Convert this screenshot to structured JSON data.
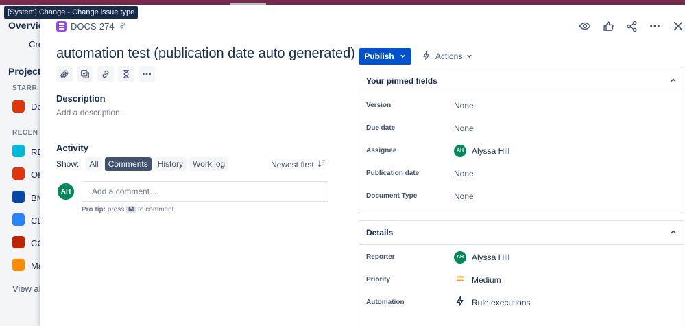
{
  "tooltip": "[System] Change - Change issue type",
  "background_sidebar": {
    "overview": "Overvie",
    "create": "Cre",
    "projects": "Projects",
    "starred": "STARR",
    "starred_item": "Do",
    "recent": "RECEN",
    "recent_items": [
      "RE",
      "OF",
      "BM",
      "CD",
      "CC",
      "Ma"
    ],
    "view_all": "View all"
  },
  "issue": {
    "key": "DOCS-274",
    "title": "automation test (publication date auto generated)"
  },
  "description": {
    "label": "Description",
    "placeholder": "Add a description..."
  },
  "activity": {
    "label": "Activity",
    "show_label": "Show:",
    "filters": [
      "All",
      "Comments",
      "History",
      "Work log"
    ],
    "active_filter": "Comments",
    "sort": "Newest first",
    "comment_placeholder": "Add a comment...",
    "protip_prefix": "Pro tip:",
    "protip_middle": "press",
    "protip_key": "M",
    "protip_suffix": "to comment",
    "avatar_initials": "AH"
  },
  "header_actions": {
    "publish": "Publish",
    "actions": "Actions"
  },
  "pinned_fields": {
    "title": "Your pinned fields",
    "rows": [
      {
        "label": "Version",
        "value": "None"
      },
      {
        "label": "Due date",
        "value": "None"
      },
      {
        "label": "Assignee",
        "value": "Alyssa Hill",
        "avatar": "AH"
      },
      {
        "label": "Publication date",
        "value": "None"
      },
      {
        "label": "Document Type",
        "value": "None"
      }
    ]
  },
  "details": {
    "title": "Details",
    "reporter_label": "Reporter",
    "reporter_value": "Alyssa Hill",
    "reporter_avatar": "AH",
    "priority_label": "Priority",
    "priority_value": "Medium",
    "automation_label": "Automation",
    "automation_value": "Rule executions"
  },
  "colors": {
    "primary": "#0052cc",
    "avatar": "#00875a",
    "priority": "#ff991f",
    "issue_type": "#904ee2"
  }
}
